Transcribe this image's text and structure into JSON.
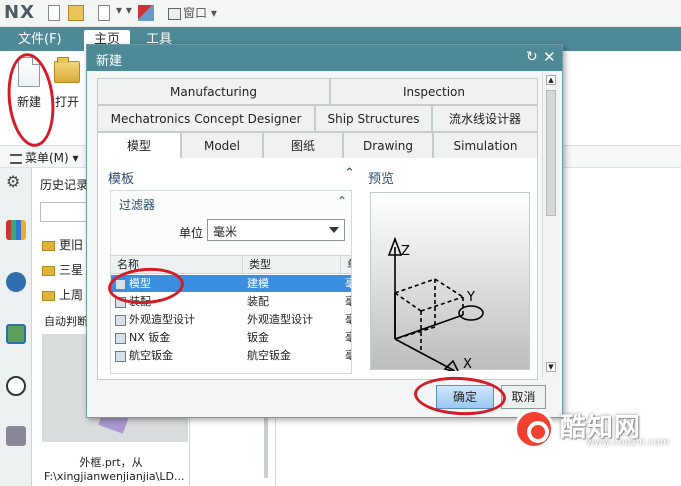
{
  "app": {
    "logo": "NX",
    "qat_window_label": "窗口 ▾",
    "qat_arrow": "▾ ▾"
  },
  "ribbon": {
    "tabs": {
      "file": "文件(F)",
      "home": "主页",
      "tools": "工具"
    },
    "buttons": {
      "new": "新建",
      "open": "打开"
    }
  },
  "menubar": {
    "menu": "菜单(M) ▾"
  },
  "history": {
    "title": "历史记录",
    "items": [
      "更旧",
      "三星",
      "上周"
    ],
    "auto_label": "自动判断",
    "thumb_caption": "外框.prt，从",
    "thumb_path": "F:\\xingjianwenjianjia\\LD..."
  },
  "dialog": {
    "title": "新建",
    "reset_icon": "↻",
    "close_icon": "✕",
    "tabs_row1": [
      "Manufacturing",
      "Inspection"
    ],
    "tabs_row2": [
      "Mechatronics Concept Designer",
      "Ship Structures",
      "流水线设计器"
    ],
    "tabs_row3": [
      "模型",
      "Model",
      "图纸",
      "Drawing",
      "Simulation"
    ],
    "section_templates": "模板",
    "section_preview": "预览",
    "filter": {
      "heading": "过滤器",
      "unit_label": "单位",
      "unit_value": "毫米"
    },
    "table": {
      "headers": [
        "名称",
        "类型",
        "单"
      ],
      "rows": [
        {
          "name": "模型",
          "type": "建模",
          "unit": "毫"
        },
        {
          "name": "装配",
          "type": "装配",
          "unit": "毫"
        },
        {
          "name": "外观造型设计",
          "type": "外观造型设计",
          "unit": "毫"
        },
        {
          "name": "NX 钣金",
          "type": "钣金",
          "unit": "毫"
        },
        {
          "name": "航空钣金",
          "type": "航空钣金",
          "unit": "毫"
        }
      ],
      "selected_index": 0
    },
    "preview_axes": {
      "z": "Z",
      "y": "Y",
      "x": "X"
    },
    "ok": "确定",
    "cancel": "取消"
  },
  "watermark": {
    "brand": "酷知网",
    "url": "www.coozhi.com"
  },
  "colors": {
    "title_bar": "#4d8a96",
    "selection": "#3c8ee0",
    "annotation": "#d41c28"
  }
}
